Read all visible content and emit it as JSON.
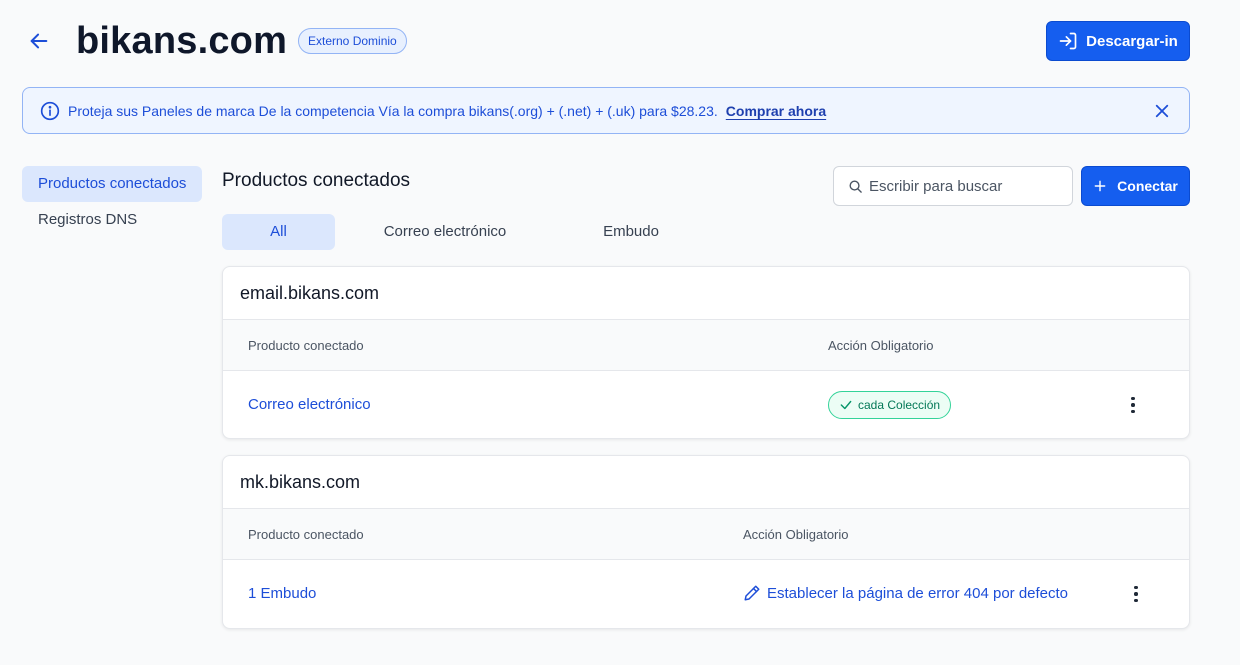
{
  "header": {
    "title": "bikans.com",
    "badge": "Externo Dominio",
    "download_label": "Descargar-in"
  },
  "banner": {
    "text": "Proteja sus Paneles de marca De la competencia Vía la compra bikans(.org) + (.net) + (.uk) para $28.23.",
    "link": "Comprar ahora"
  },
  "sidebar": {
    "items": [
      {
        "label": "Productos conectados",
        "active": true
      },
      {
        "label": "Registros DNS",
        "active": false
      }
    ]
  },
  "main": {
    "title": "Productos conectados",
    "search_placeholder": "Escribir para buscar",
    "connect_label": "Conectar",
    "tabs": [
      {
        "label": "All",
        "active": true
      },
      {
        "label": "Correo electrónico",
        "active": false
      },
      {
        "label": "Embudo",
        "active": false
      }
    ]
  },
  "cards": [
    {
      "domain": "email.bikans.com",
      "col_product": "Producto conectado",
      "col_action": "Acción Obligatorio",
      "product": "Correo electrónico",
      "action": "cada Colección",
      "action_type": "status-success"
    },
    {
      "domain": "mk.bikans.com",
      "col_product": "Producto conectado",
      "col_action": "Acción Obligatorio",
      "product": "1 Embudo",
      "action": "Establecer la página de error 404 por defecto",
      "action_type": "edit-link"
    }
  ],
  "colors": {
    "primary": "#155eef",
    "accent_text": "#1d4ed8",
    "active_bg": "#dbe7fd",
    "success": "#047857"
  }
}
